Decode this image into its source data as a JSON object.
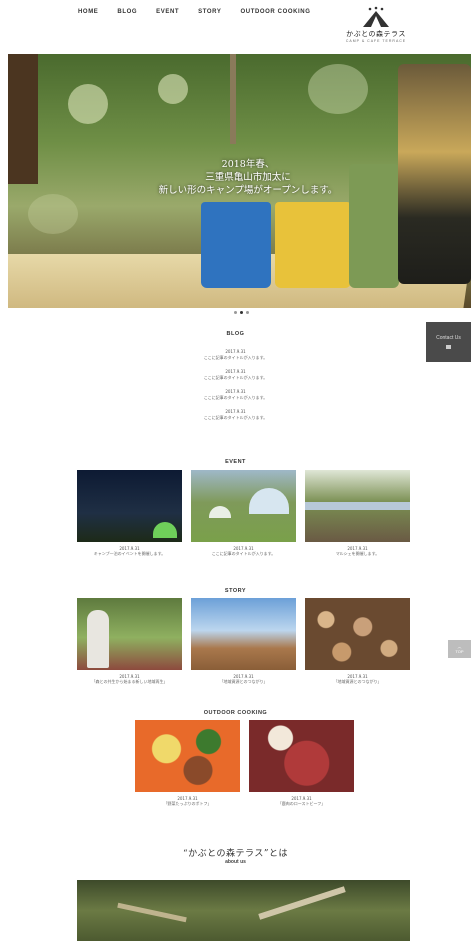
{
  "nav": {
    "items": [
      "HOME",
      "BLOG",
      "EVENT",
      "STORY",
      "OUTDOOR COOKING"
    ]
  },
  "logo": {
    "name": "かぶとの森テラス",
    "sub": "CAMP & CAFE TERRACE"
  },
  "hero": {
    "line1": "2018年春、",
    "line2": "三重県亀山市加太に",
    "line3": "新しい形のキャンプ場がオープンします。"
  },
  "contact": {
    "label": "Contact Us"
  },
  "totop": {
    "label": "TOP"
  },
  "blog": {
    "title": "BLOG",
    "items": [
      {
        "date": "2017.9.31",
        "text": "ここに記事のタイトルが入ります。"
      },
      {
        "date": "2017.9.31",
        "text": "ここに記事のタイトルが入ります。"
      },
      {
        "date": "2017.9.31",
        "text": "ここに記事のタイトルが入ります。"
      },
      {
        "date": "2017.9.31",
        "text": "ここに記事のタイトルが入ります。"
      }
    ]
  },
  "event": {
    "title": "EVENT",
    "items": [
      {
        "date": "2017.9.31",
        "text": "キャンプ一泊のイベントを開催します。"
      },
      {
        "date": "2017.9.31",
        "text": "ここに記事のタイトルが入ります。"
      },
      {
        "date": "2017.9.31",
        "text": "マルシェを開催します。"
      }
    ]
  },
  "story": {
    "title": "STORY",
    "items": [
      {
        "date": "2017.9.31",
        "text": "「森との共生から始まる新しい地域再生」"
      },
      {
        "date": "2017.9.31",
        "text": "「地域資源とのつながり」"
      },
      {
        "date": "2017.9.31",
        "text": "「地域資源とのつながり」"
      }
    ]
  },
  "cooking": {
    "title": "OUTDOOR COOKING",
    "items": [
      {
        "date": "2017.9.31",
        "text": "「野菜たっぷりのポトフ」"
      },
      {
        "date": "2017.9.31",
        "text": "「鹿肉のローストビーフ」"
      }
    ]
  },
  "about": {
    "title": "“かぶとの森テラス”とは",
    "sub": "about us"
  }
}
